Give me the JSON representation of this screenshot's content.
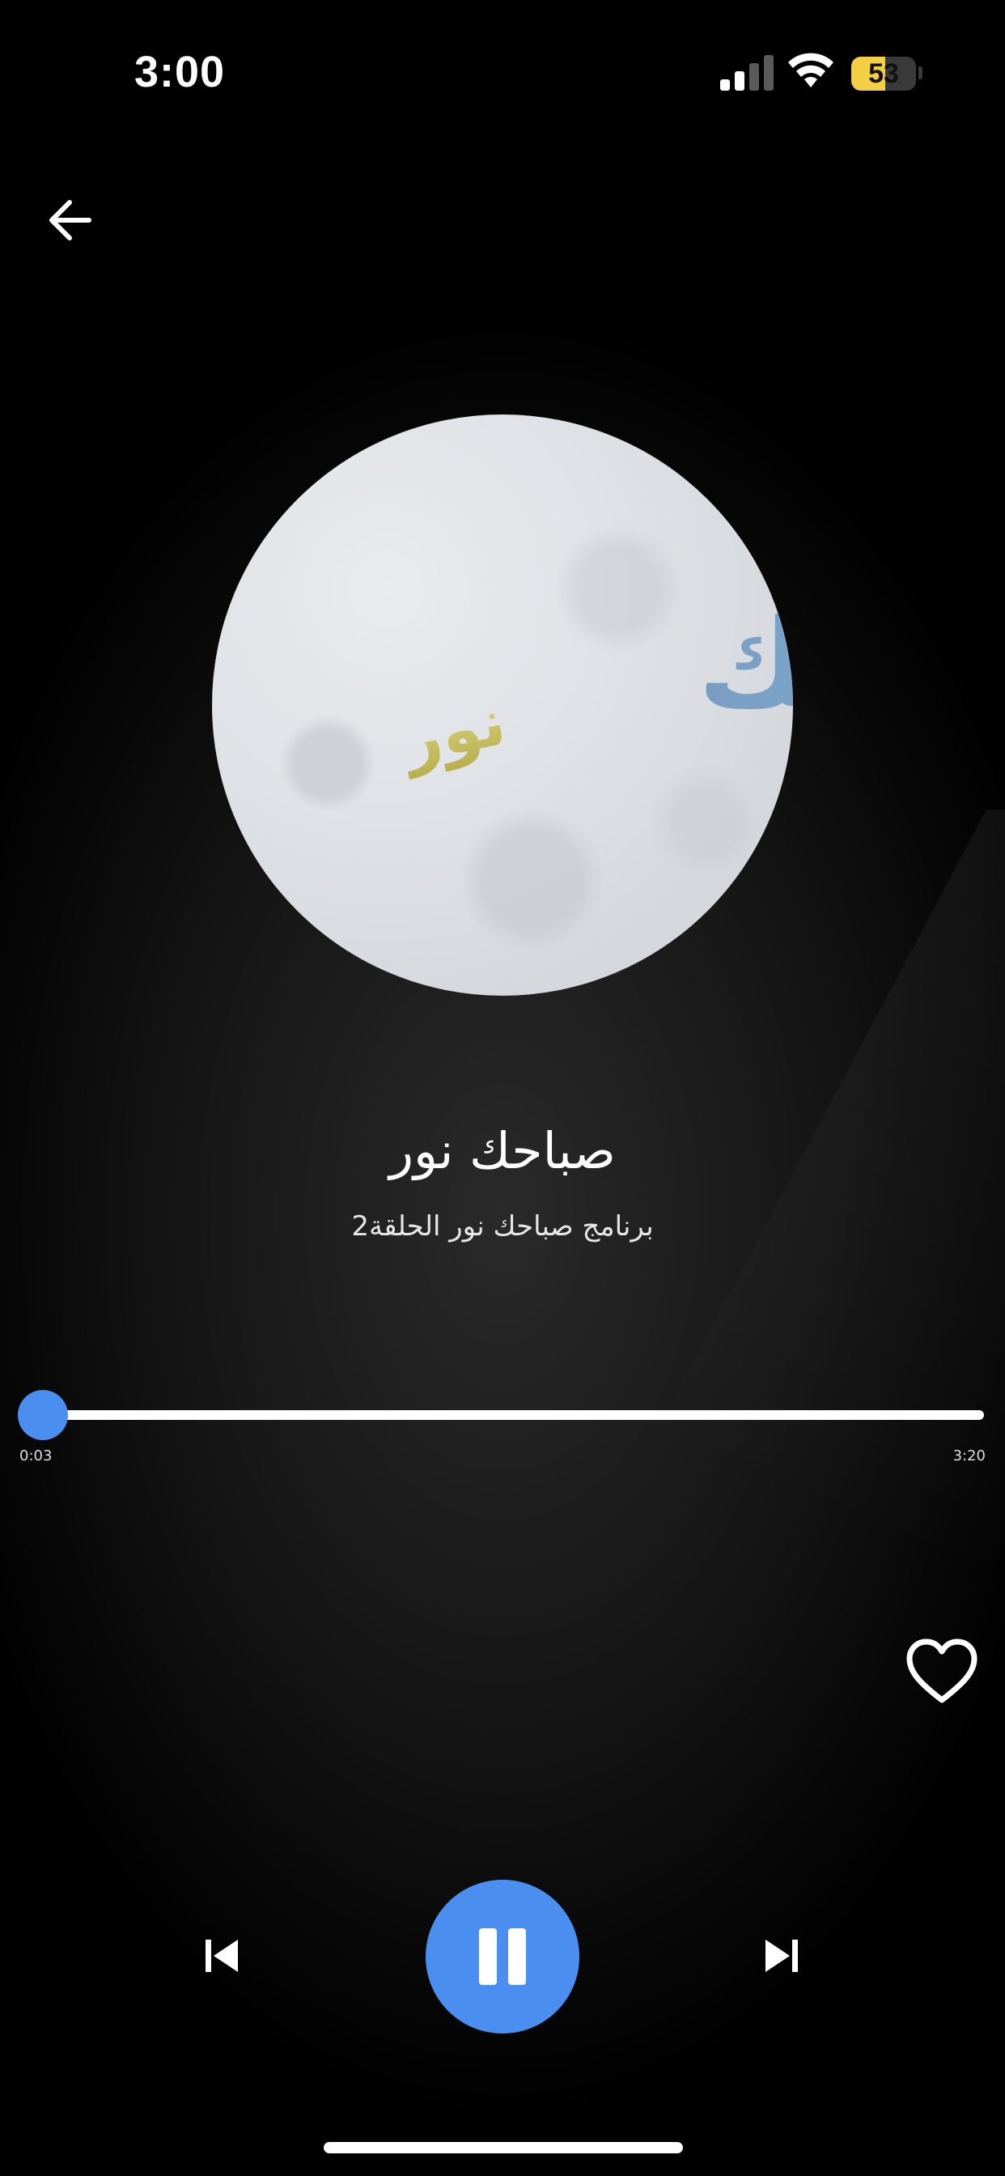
{
  "status_bar": {
    "time": "3:00",
    "battery_level": "53",
    "battery_fraction": 0.53,
    "signal_bars_active": 2,
    "signal_bars_total": 4,
    "wifi_icon": "wifi-icon",
    "battery_color": "#f2cf45"
  },
  "nav": {
    "back_icon": "arrow-left-icon"
  },
  "artwork": {
    "description_icon": "album-artwork",
    "logo_text_main": "صباحك",
    "logo_text_small": "نور"
  },
  "track": {
    "title": "صباحك نور",
    "subtitle": "برنامج صباحك نور الحلقة2"
  },
  "progress": {
    "current_time": "0:03",
    "total_time": "3:20",
    "fraction": 0.015
  },
  "controls": {
    "favorite_icon": "heart-outline-icon",
    "previous_icon": "skip-previous-icon",
    "pause_icon": "pause-icon",
    "next_icon": "skip-next-icon",
    "accent_color": "#4a8ff0"
  }
}
